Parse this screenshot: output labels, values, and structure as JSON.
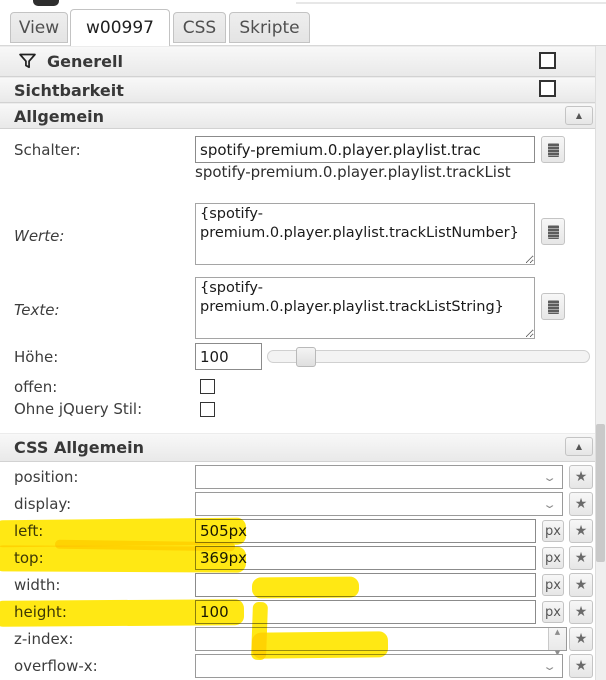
{
  "tabs": {
    "items": [
      {
        "label": "View",
        "active": false
      },
      {
        "label": "w00997",
        "active": true
      },
      {
        "label": "CSS",
        "active": false
      },
      {
        "label": "Skripte",
        "active": false
      }
    ]
  },
  "accordion": {
    "generell_title": "Generell",
    "sichtbarkeit_title": "Sichtbarkeit",
    "allgemein_title": "Allgemein",
    "css_allgemein_title": "CSS Allgemein"
  },
  "allgemein": {
    "schalter_label": "Schalter:",
    "schalter_value": "spotify-premium.0.player.playlist.trac",
    "schalter_helper": "spotify-premium.0.player.playlist.trackList",
    "werte_label": "Werte:",
    "werte_value": "{spotify-premium.0.player.playlist.trackListNumber}",
    "texte_label": "Texte:",
    "texte_value": "{spotify-premium.0.player.playlist.trackListString}",
    "hoehe_label": "Höhe:",
    "hoehe_value": "100",
    "offen_label": "offen:",
    "ohne_jquery_label": "Ohne jQuery Stil:"
  },
  "css": {
    "px_label": "px",
    "rows": [
      {
        "label": "position:",
        "value": "",
        "type": "select"
      },
      {
        "label": "display:",
        "value": "",
        "type": "select"
      },
      {
        "label": "left:",
        "value": "505px",
        "type": "px"
      },
      {
        "label": "top:",
        "value": "369px",
        "type": "px"
      },
      {
        "label": "width:",
        "value": "",
        "type": "px"
      },
      {
        "label": "height:",
        "value": "100",
        "type": "px"
      },
      {
        "label": "z-index:",
        "value": "",
        "type": "spinner"
      },
      {
        "label": "overflow-x:",
        "value": "",
        "type": "select"
      }
    ]
  },
  "colors": {
    "highlight": "#ffe600",
    "header_text": "#383838",
    "button_glyph": "#6a6a6a"
  }
}
